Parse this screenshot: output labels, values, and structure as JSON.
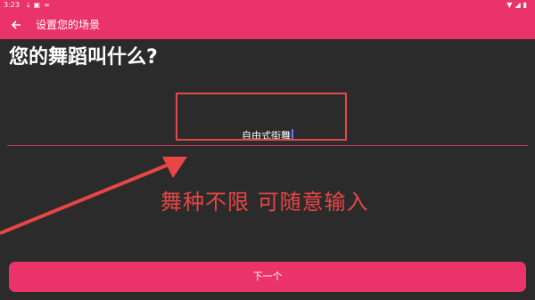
{
  "status_bar": {
    "time": "3:23"
  },
  "app_bar": {
    "title": "设置您的场景"
  },
  "question": "您的舞蹈叫什么?",
  "dance_input": {
    "value": "自由式街舞"
  },
  "annotation": "舞种不限  可随意输入",
  "next_button": {
    "label": "下一个"
  },
  "colors": {
    "accent": "#ea3369",
    "background": "#2b2b2b",
    "annotation": "#e84545"
  }
}
